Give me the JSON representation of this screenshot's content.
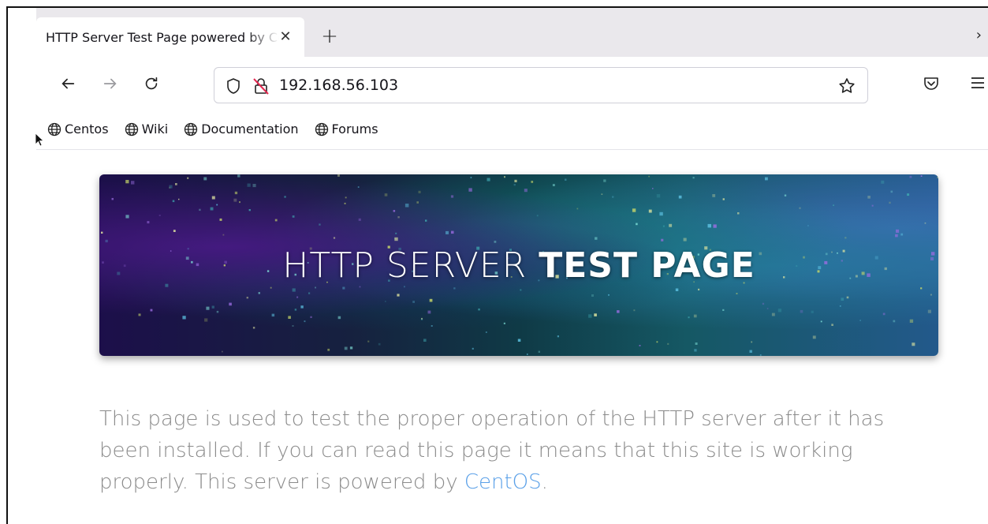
{
  "browser": {
    "tab": {
      "title": "HTTP Server Test Page powered by CentOS"
    },
    "url": "192.168.56.103",
    "bookmarks": [
      {
        "label": "Centos"
      },
      {
        "label": "Wiki"
      },
      {
        "label": "Documentation"
      },
      {
        "label": "Forums"
      }
    ]
  },
  "page": {
    "hero": {
      "title_light": "HTTP SERVER",
      "title_bold": "TEST PAGE"
    },
    "intro": {
      "text": "This page is used to test the proper operation of the HTTP server after it has been installed. If you can read this page it means that this site is working properly. This server is powered by ",
      "link_label": "CentOS",
      "suffix": "."
    }
  },
  "colors": {
    "link": "#5aa0e8",
    "body_text": "#8b8b8b",
    "tabstrip": "#eae8ec"
  }
}
